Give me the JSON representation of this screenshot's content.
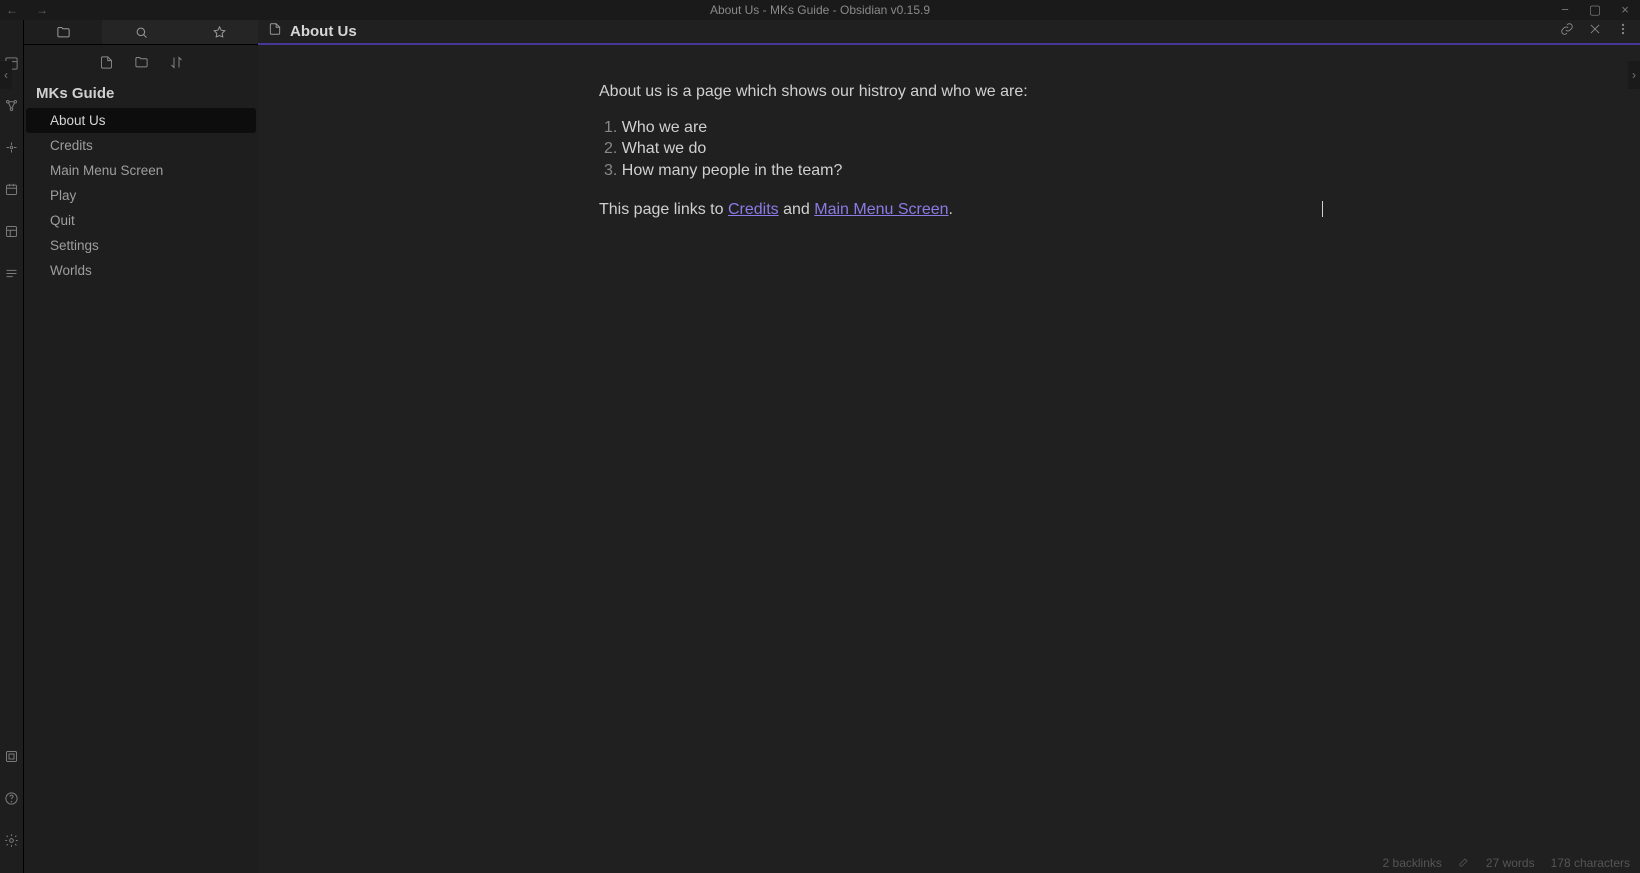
{
  "window": {
    "title": "About Us - MKs Guide - Obsidian v0.15.9"
  },
  "sidebar": {
    "vault_name": "MKs Guide",
    "files": [
      {
        "name": "About Us",
        "active": true
      },
      {
        "name": "Credits",
        "active": false
      },
      {
        "name": "Main Menu Screen",
        "active": false
      },
      {
        "name": "Play",
        "active": false
      },
      {
        "name": "Quit",
        "active": false
      },
      {
        "name": "Settings",
        "active": false
      },
      {
        "name": "Worlds",
        "active": false
      }
    ]
  },
  "editor": {
    "title": "About Us",
    "content": {
      "intro": "About us is a page which shows our histroy and who we are:",
      "list": [
        "Who we are",
        "What we do",
        "How many people in the team?"
      ],
      "links_prefix": "This page links to ",
      "link1": "Credits",
      "links_mid": " and ",
      "link2": "Main Menu Screen",
      "links_suffix": "."
    }
  },
  "status": {
    "backlinks": "2 backlinks",
    "words": "27 words",
    "chars": "178 characters"
  }
}
